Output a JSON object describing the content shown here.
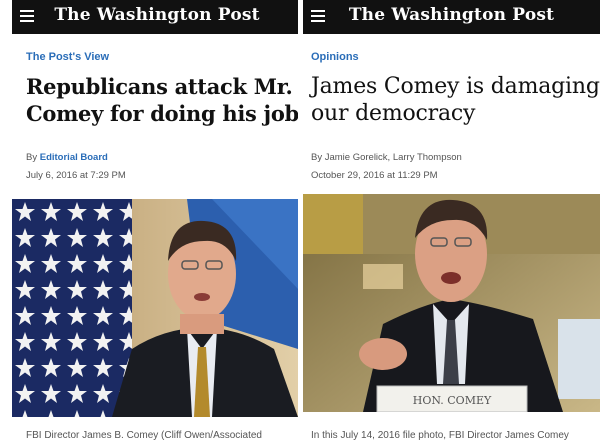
{
  "left_article": {
    "masthead": "The Washington Post",
    "section": "The Post's View",
    "headline_line1": "Republicans attack Mr.",
    "headline_line2": "Comey for doing his job",
    "byline_prefix": "By",
    "author": "Editorial Board",
    "date": "July 6, 2016 at 7:29 PM",
    "caption": "FBI Director James B. Comey (Cliff Owen/Associated"
  },
  "right_article": {
    "masthead": "The Washington Post",
    "section": "Opinions",
    "headline_line1": "James Comey is damaging",
    "headline_line2": "our democracy",
    "byline": "By Jamie Gorelick, Larry Thompson",
    "date": "October 29, 2016 at 11:29 PM",
    "nameplate": "HON. COMEY",
    "caption": "In this July 14, 2016 file photo, FBI Director James Comey"
  }
}
